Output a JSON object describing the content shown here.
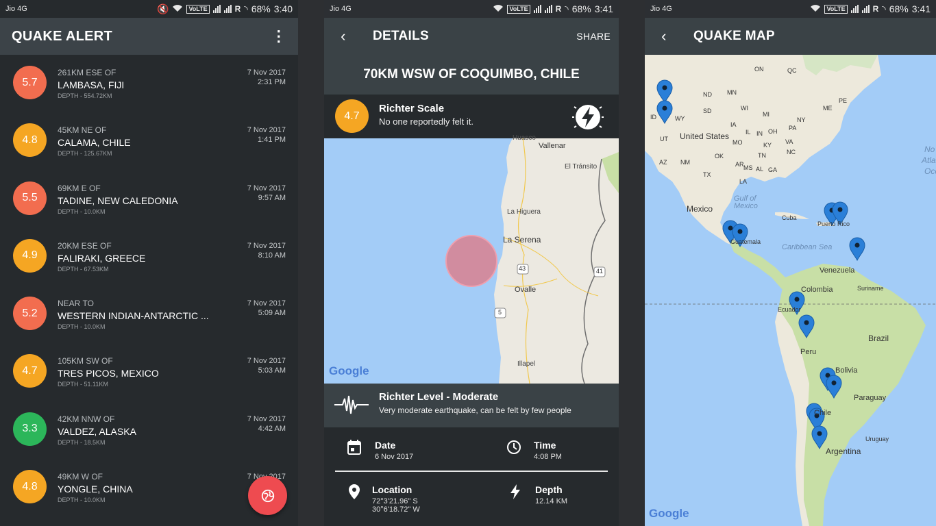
{
  "status": {
    "carrier": "Jio 4G",
    "volte": "VoLTE",
    "roaming": "R",
    "battery": "68%",
    "times": [
      "3:40",
      "3:41",
      "3:41"
    ]
  },
  "list_screen": {
    "title": "QUAKE ALERT",
    "menu_icon": "more-vert-icon",
    "quakes": [
      {
        "mag": "5.7",
        "color": "#f26d4f",
        "sub": "261KM ESE OF",
        "place": "LAMBASA, FIJI",
        "depth": "DEPTH - 554.72KM",
        "date": "7 Nov 2017",
        "time": "2:31 PM"
      },
      {
        "mag": "4.8",
        "color": "#f5a623",
        "sub": "45KM NE OF",
        "place": "CALAMA, CHILE",
        "depth": "DEPTH - 125.67KM",
        "date": "7 Nov 2017",
        "time": "1:41 PM"
      },
      {
        "mag": "5.5",
        "color": "#f26d4f",
        "sub": "69KM E OF",
        "place": "TADINE, NEW CALEDONIA",
        "depth": "DEPTH - 10.0KM",
        "date": "7 Nov 2017",
        "time": "9:57 AM"
      },
      {
        "mag": "4.9",
        "color": "#f5a623",
        "sub": "20KM ESE OF",
        "place": "FALIRAKI, GREECE",
        "depth": "DEPTH - 67.53KM",
        "date": "7 Nov 2017",
        "time": "8:10 AM"
      },
      {
        "mag": "5.2",
        "color": "#f26d4f",
        "sub": "NEAR TO",
        "place": "WESTERN INDIAN-ANTARCTIC ...",
        "depth": "DEPTH - 10.0KM",
        "date": "7 Nov 2017",
        "time": "5:09 AM"
      },
      {
        "mag": "4.7",
        "color": "#f5a623",
        "sub": "105KM SW OF",
        "place": "TRES PICOS, MEXICO",
        "depth": "DEPTH - 51.11KM",
        "date": "7 Nov 2017",
        "time": "5:03 AM"
      },
      {
        "mag": "3.3",
        "color": "#2cb65a",
        "sub": "42KM NNW OF",
        "place": "VALDEZ, ALASKA",
        "depth": "DEPTH - 18.5KM",
        "date": "7 Nov 2017",
        "time": "4:42 AM"
      },
      {
        "mag": "4.8",
        "color": "#f5a623",
        "sub": "49KM W OF",
        "place": "YONGLE, CHINA",
        "depth": "DEPTH - 10.0KM",
        "date": "7 Nov 2017",
        "time": ""
      }
    ],
    "fab_icon": "globe-icon"
  },
  "details_screen": {
    "title": "DETAILS",
    "share": "SHARE",
    "location_title": "70KM WSW OF COQUIMBO, CHILE",
    "magnitude": "4.7",
    "magnitude_color": "#f5a623",
    "scale_label": "Richter Scale",
    "scale_desc": "No one reportedly felt it.",
    "map_labels": {
      "huasco": "Huasco",
      "vallenar": "Vallenar",
      "el_transito": "El Tránsito",
      "la_higuera": "La Higuera",
      "la_serena": "La Serena",
      "ovalle": "Ovalle",
      "illapel": "Illapel",
      "route_43": "43",
      "route_41": "41",
      "route_5": "5",
      "google": "Google"
    },
    "level_title": "Richter Level - Moderate",
    "level_desc": "Very moderate earthquake, can be felt by few people",
    "date_label": "Date",
    "date_value": "6 Nov 2017",
    "time_label": "Time",
    "time_value": "4:08 PM",
    "location_label": "Location",
    "location_lat": "72°3'21.96\" S",
    "location_lon": "30°6'18.72\" W",
    "depth_label": "Depth",
    "depth_value": "12.14 KM"
  },
  "map_screen": {
    "title": "QUAKE MAP",
    "labels": {
      "on": "ON",
      "qc": "QC",
      "nd": "ND",
      "mn": "MN",
      "me": "ME",
      "pe": "PE",
      "sd": "SD",
      "wi": "WI",
      "mi": "MI",
      "ny": "NY",
      "id": "ID",
      "wy": "WY",
      "ia": "IA",
      "oh": "OH",
      "pa": "PA",
      "in": "IN",
      "il": "IL",
      "ut": "UT",
      "us": "United States",
      "mo": "MO",
      "ky": "KY",
      "va": "VA",
      "az": "AZ",
      "nm": "NM",
      "ok": "OK",
      "tn": "TN",
      "nc": "NC",
      "ar": "AR",
      "ms": "MS",
      "al": "AL",
      "ga": "GA",
      "tx": "TX",
      "la": "LA",
      "no": "No",
      "atla": "Atla",
      "oce": "Oce",
      "gulf": "Gulf of",
      "mexico_gulf": "Mexico",
      "mexico": "Mexico",
      "cuba": "Cuba",
      "puerto_rico": "Puerto Rico",
      "guatemala": "Guatemala",
      "caribbean": "Caribbean Sea",
      "venezuela": "Venezuela",
      "colombia": "Colombia",
      "suriname": "Suriname",
      "ecuador": "Ecuador",
      "brazil": "Brazil",
      "peru": "Peru",
      "bolivia": "Bolivia",
      "paraguay": "Paraguay",
      "chile": "Chile",
      "uruguay": "Uruguay",
      "argentina": "Argentina",
      "google": "Google"
    }
  }
}
